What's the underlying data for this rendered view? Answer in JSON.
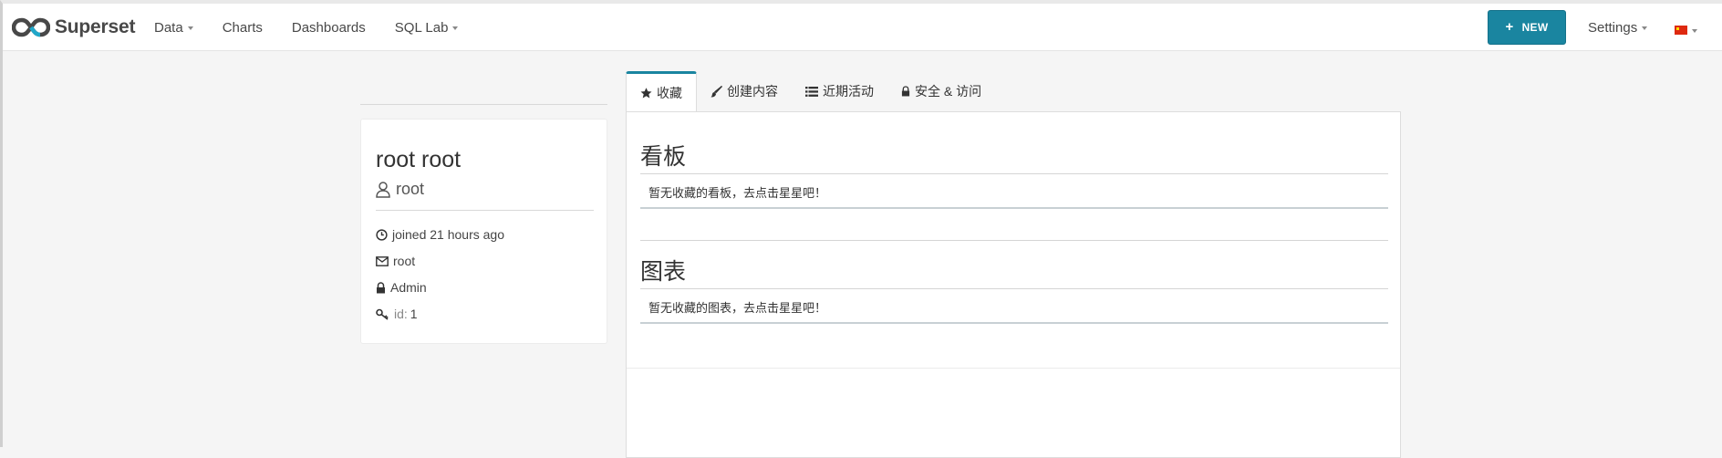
{
  "app": {
    "brand": "Superset"
  },
  "nav": {
    "items": [
      {
        "label": "Data",
        "dropdown": true
      },
      {
        "label": "Charts",
        "dropdown": false
      },
      {
        "label": "Dashboards",
        "dropdown": false
      },
      {
        "label": "SQL Lab",
        "dropdown": true
      }
    ],
    "new_button": {
      "icon": "+",
      "label": "NEW"
    },
    "settings_label": "Settings",
    "language_icon": "china-flag-icon"
  },
  "profile": {
    "full_name": "root root",
    "username": "root",
    "joined": "joined 21 hours ago",
    "email": "root",
    "role": "Admin",
    "id_label": "id:",
    "id_value": "1"
  },
  "tabs": [
    {
      "label": "收藏",
      "icon": "star-icon",
      "active": true
    },
    {
      "label": "创建内容",
      "icon": "paint-brush-icon",
      "active": false
    },
    {
      "label": "近期活动",
      "icon": "list-icon",
      "active": false
    },
    {
      "label": "安全 & 访问",
      "icon": "lock-icon",
      "active": false
    }
  ],
  "favorites": {
    "dashboards": {
      "title": "看板",
      "empty": "暂无收藏的看板，去点击星星吧！"
    },
    "charts": {
      "title": "图表",
      "empty": "暂无收藏的图表，去点击星星吧！"
    }
  },
  "colors": {
    "accent": "#1a85a0",
    "flag_red": "#de2910"
  }
}
